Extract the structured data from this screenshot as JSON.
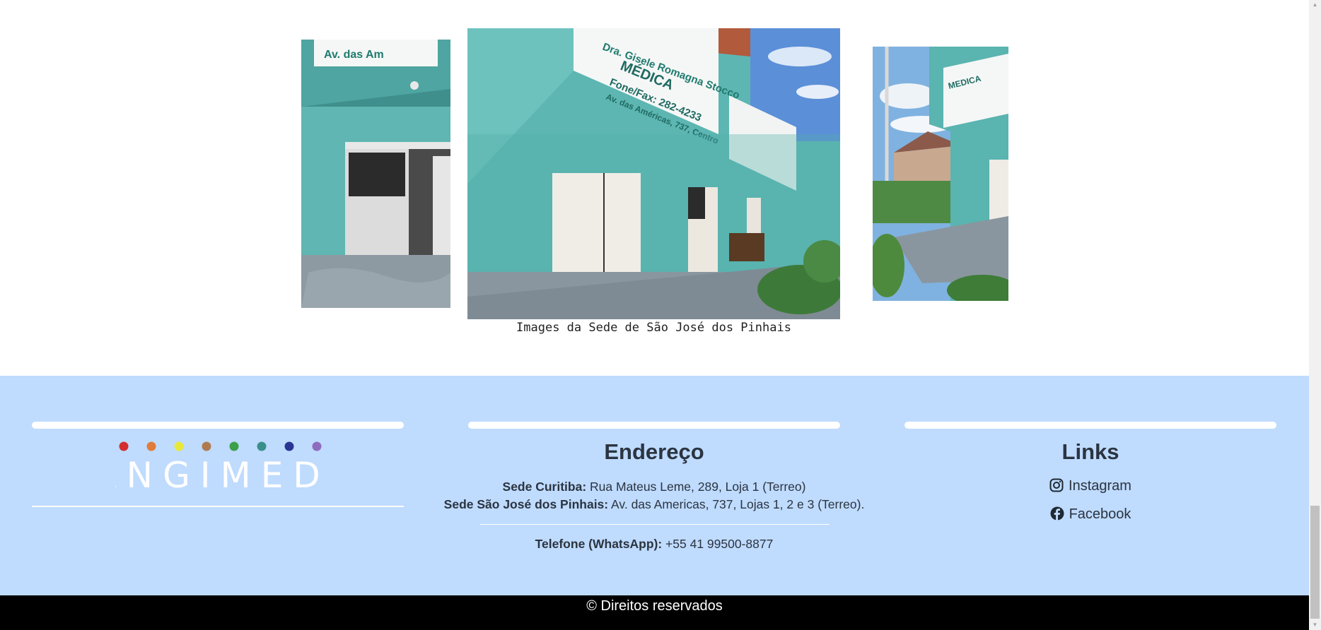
{
  "gallery": {
    "caption": "Images da Sede de São José dos Pinhais",
    "sign_address": "Av. das Américas, 737, Centro",
    "sign_name": "Dra. Gisele Romagna Stocco",
    "sign_medica": "MÉDICA",
    "sign_phone": "Fone/Fax: 282-4233"
  },
  "footer": {
    "logo_text": "ANGIMEDI",
    "logo_dot_colors": [
      "#d32f2f",
      "#e07b39",
      "#e8e83a",
      "#b07a50",
      "#3aa04a",
      "#3a8f8a",
      "#283593",
      "#8e6bbf"
    ],
    "address": {
      "title": "Endereço",
      "line1_label": "Sede Curitiba:",
      "line1_value": "Rua Mateus Leme, 289, Loja 1 (Terreo)",
      "line2_label": "Sede São José dos Pinhais:",
      "line2_value": "Av. das Americas, 737, Lojas 1, 2 e 3 (Terreo).",
      "phone_label": "Telefone (WhatsApp):",
      "phone_value": "+55 41 99500-8877"
    },
    "links": {
      "title": "Links",
      "items": [
        {
          "label": "Instagram",
          "icon": "instagram-icon"
        },
        {
          "label": "Facebook",
          "icon": "facebook-icon"
        }
      ]
    }
  },
  "copyright": "© Direitos reservados",
  "colors": {
    "footer_bg": "#bfdbfe",
    "copyright_bg": "#000000",
    "wall_teal": "#5fb8b4"
  }
}
